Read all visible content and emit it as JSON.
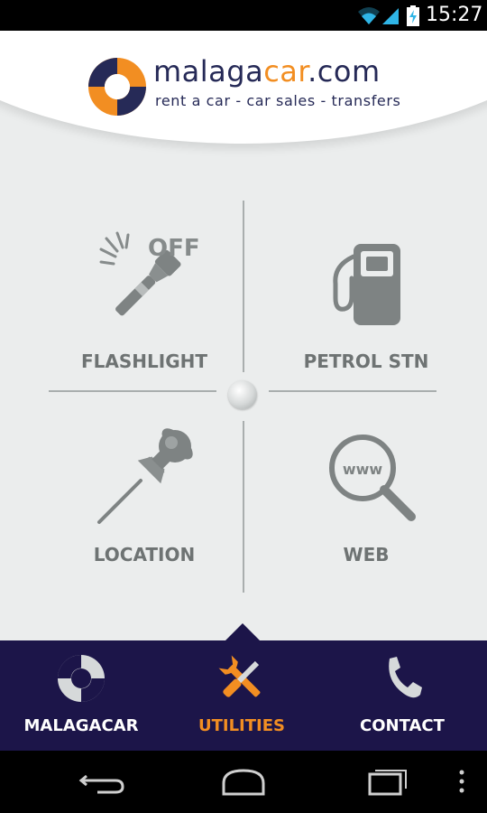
{
  "status_bar": {
    "time": "15:27",
    "icons": [
      "wifi-icon",
      "signal-icon",
      "battery-charging-icon"
    ]
  },
  "header": {
    "brand_prefix": "malaga",
    "brand_accent": "car",
    "brand_suffix": ".com",
    "tagline": "rent a car - car sales - transfers",
    "colors": {
      "navy": "#262a57",
      "orange": "#f28e22"
    }
  },
  "utilities": {
    "flashlight": {
      "label": "FLASHLIGHT",
      "state": "OFF",
      "icon": "flashlight-icon"
    },
    "petrol": {
      "label": "PETROL STN",
      "icon": "fuel-pump-icon"
    },
    "location": {
      "label": "LOCATION",
      "icon": "pushpin-icon"
    },
    "web": {
      "label": "WEB",
      "icon": "magnifier-www-icon",
      "icon_text": "www"
    }
  },
  "tabs": [
    {
      "label": "MALAGACAR",
      "icon": "lifebuoy-icon",
      "active": false
    },
    {
      "label": "UTILITIES",
      "icon": "tools-icon",
      "active": true
    },
    {
      "label": "CONTACT",
      "icon": "phone-icon",
      "active": false
    }
  ],
  "navbar": {
    "icons": [
      "back-icon",
      "home-icon",
      "recent-apps-icon",
      "overflow-menu-icon"
    ]
  }
}
